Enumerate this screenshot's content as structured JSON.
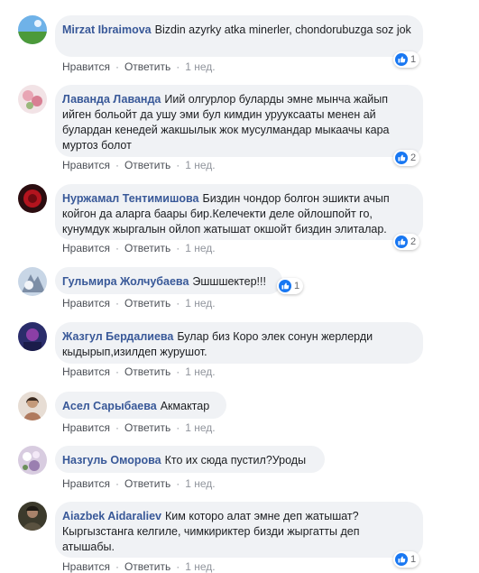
{
  "comments": [
    {
      "author": "Mirzat Ibraimova",
      "text": "Bizdin azyrky atka minerler, chondorubuzga soz jok",
      "like_label": "Нравится",
      "reply_label": "Ответить",
      "time": "1 нед.",
      "reactions": "1"
    },
    {
      "author": "Лаванда Лаванда",
      "text": "Иий олгурлор буларды эмне мынча жайып ийген больойт да ушу эми бул кимдин урууксааты менен ай булардан кенедей жакшылык жок мусулмандар мыкаачы кара муртоз болот",
      "like_label": "Нравится",
      "reply_label": "Ответить",
      "time": "1 нед.",
      "reactions": "2"
    },
    {
      "author": "Нуржамал Тентимишова",
      "text": "Биздин чондор болгон эшикти ачып койгон да аларга баары бир.Келечекти деле ойлошпойт го, кунумдук жыргалын ойлоп жатышат окшойт биздин элиталар.",
      "like_label": "Нравится",
      "reply_label": "Ответить",
      "time": "1 нед.",
      "reactions": "2"
    },
    {
      "author": "Гульмира Жолчубаева",
      "text": "Эшшшектер!!!",
      "like_label": "Нравится",
      "reply_label": "Ответить",
      "time": "1 нед.",
      "reactions": "1"
    },
    {
      "author": "Жазгул Бердалиева",
      "text": "Булар биз Коро элек сонун жерлерди кыдырып,изилдеп журушот.",
      "like_label": "Нравится",
      "reply_label": "Ответить",
      "time": "1 нед.",
      "reactions": ""
    },
    {
      "author": "Асел Сарыбаева",
      "text": "Акмактар",
      "like_label": "Нравится",
      "reply_label": "Ответить",
      "time": "1 нед.",
      "reactions": ""
    },
    {
      "author": "Назгуль Оморова",
      "text": "Кто их сюда пустил?Уроды",
      "like_label": "Нравится",
      "reply_label": "Ответить",
      "time": "1 нед.",
      "reactions": ""
    },
    {
      "author": "Aiazbek Aidaraliev",
      "text": "Ким которо алат эмне деп жатышат? Кыргызстанга келгиле, чимкириктер бизди жыргатты деп атышабы.",
      "like_label": "Нравится",
      "reply_label": "Ответить",
      "time": "1 нед.",
      "reactions": "1"
    }
  ],
  "colors": {
    "author": "#385898",
    "bubble": "#f0f2f5",
    "like": "#1877f2"
  }
}
